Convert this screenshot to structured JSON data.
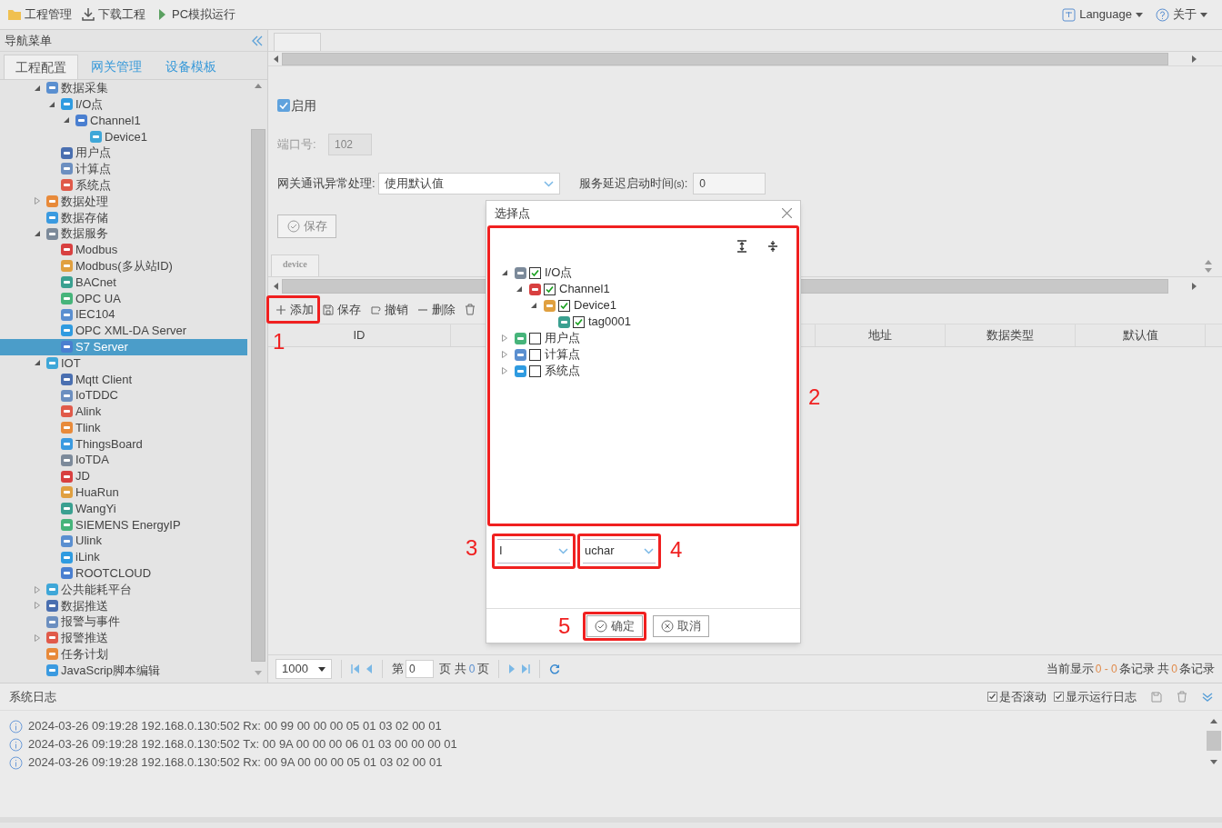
{
  "toolbar": {
    "left": [
      {
        "label": "工程管理"
      },
      {
        "label": "下载工程"
      },
      {
        "label": "PC模拟运行"
      }
    ],
    "right": [
      {
        "label": "Language"
      },
      {
        "label": "关于"
      }
    ]
  },
  "sidebar": {
    "title": "导航菜单",
    "tabs": [
      {
        "label": "工程配置",
        "selected": true
      },
      {
        "label": "网关管理",
        "selected": false
      },
      {
        "label": "设备模板",
        "selected": false
      }
    ],
    "tree": [
      {
        "label": "数据采集",
        "expanded": true,
        "selected": false,
        "children": [
          {
            "label": "I/O点",
            "expanded": true,
            "selected": false,
            "children": [
              {
                "label": "Channel1",
                "expanded": true,
                "selected": false,
                "children": [
                  {
                    "label": "Device1",
                    "selected": false
                  }
                ]
              }
            ]
          },
          {
            "label": "用户点",
            "selected": false
          },
          {
            "label": "计算点",
            "selected": false
          },
          {
            "label": "系统点",
            "selected": false
          }
        ]
      },
      {
        "label": "数据处理",
        "expanded": false,
        "selected": false
      },
      {
        "label": "数据存储",
        "selected": false
      },
      {
        "label": "数据服务",
        "expanded": true,
        "selected": false,
        "children": [
          {
            "label": "Modbus",
            "selected": false
          },
          {
            "label": "Modbus(多从站ID)",
            "selected": false
          },
          {
            "label": "BACnet",
            "selected": false
          },
          {
            "label": "OPC UA",
            "selected": false
          },
          {
            "label": "IEC104",
            "selected": false
          },
          {
            "label": "OPC XML-DA Server",
            "selected": false
          },
          {
            "label": "S7 Server",
            "selected": true
          }
        ]
      },
      {
        "label": "IOT",
        "expanded": true,
        "selected": false,
        "children": [
          {
            "label": "Mqtt Client",
            "selected": false
          },
          {
            "label": "IoTDDC",
            "selected": false
          },
          {
            "label": "Alink",
            "selected": false
          },
          {
            "label": "Tlink",
            "selected": false
          },
          {
            "label": "ThingsBoard",
            "selected": false
          },
          {
            "label": "IoTDA",
            "selected": false
          },
          {
            "label": "JD",
            "selected": false
          },
          {
            "label": "HuaRun",
            "selected": false
          },
          {
            "label": "WangYi",
            "selected": false
          },
          {
            "label": "SIEMENS EnergyIP",
            "selected": false
          },
          {
            "label": "Ulink",
            "selected": false
          },
          {
            "label": "iLink",
            "selected": false
          },
          {
            "label": "ROOTCLOUD",
            "selected": false
          }
        ]
      },
      {
        "label": "公共能耗平台",
        "expanded": false,
        "selected": false
      },
      {
        "label": "数据推送",
        "expanded": false,
        "selected": false
      },
      {
        "label": "报警与事件",
        "selected": false
      },
      {
        "label": "报警推送",
        "expanded": false,
        "selected": false
      },
      {
        "label": "任务计划",
        "selected": false
      },
      {
        "label": "JavaScrip脚本编辑",
        "selected": false
      }
    ]
  },
  "form": {
    "enable": {
      "label": "启用",
      "checked": true
    },
    "port": {
      "label": "端口号:",
      "value": "102"
    },
    "error_handling": {
      "label": "网关通讯异常处理:",
      "value": "使用默认值"
    },
    "delay": {
      "label": "服务延迟启动时间",
      "unit": "(s)",
      "colon": ":",
      "value": "0"
    },
    "save": "保存"
  },
  "device_tab": {
    "label": "device"
  },
  "table_toolbar": [
    "添加",
    "保存",
    "撤销",
    "删除"
  ],
  "table": {
    "columns": [
      "ID",
      "地址",
      "数据类型",
      "默认值"
    ]
  },
  "pagination": {
    "page_size": "1000",
    "before": "第",
    "page": "0",
    "middle": "页 共",
    "pages": "0",
    "after": "页",
    "summary": [
      {
        "text": "当前显示",
        "kind": "plain"
      },
      {
        "text": "0 - 0",
        "kind": "count"
      },
      {
        "text": "条记录 共",
        "kind": "plain"
      },
      {
        "text": "0",
        "kind": "count"
      },
      {
        "text": "条记录",
        "kind": "plain"
      }
    ]
  },
  "log": {
    "title": "系统日志",
    "options": [
      {
        "label": "是否滚动",
        "checked": true
      },
      {
        "label": "显示运行日志",
        "checked": true
      }
    ],
    "lines": [
      "2024-03-26 09:19:28 192.168.0.130:502 Rx: 00 99 00 00 00 05 01 03 02 00 01",
      "2024-03-26 09:19:28 192.168.0.130:502 Tx: 00 9A 00 00 00 06 01 03 00 00 00 01",
      "2024-03-26 09:19:28 192.168.0.130:502 Rx: 00 9A 00 00 00 05 01 03 02 00 01"
    ]
  },
  "dialog": {
    "title": "选择点",
    "tree": [
      {
        "label": "I/O点",
        "checked": true,
        "expanded": true,
        "children": [
          {
            "label": "Channel1",
            "checked": true,
            "expanded": true,
            "children": [
              {
                "label": "Device1",
                "checked": true,
                "expanded": true,
                "children": [
                  {
                    "label": "tag0001",
                    "checked": true
                  }
                ]
              }
            ]
          }
        ]
      },
      {
        "label": "用户点",
        "checked": false,
        "expanded": false
      },
      {
        "label": "计算点",
        "checked": false,
        "expanded": false
      },
      {
        "label": "系统点",
        "checked": false,
        "expanded": false
      }
    ],
    "selects": [
      "I",
      "uchar"
    ],
    "buttons": [
      "确定",
      "取消"
    ]
  },
  "annotations": [
    "1",
    "2",
    "3",
    "4",
    "5"
  ]
}
